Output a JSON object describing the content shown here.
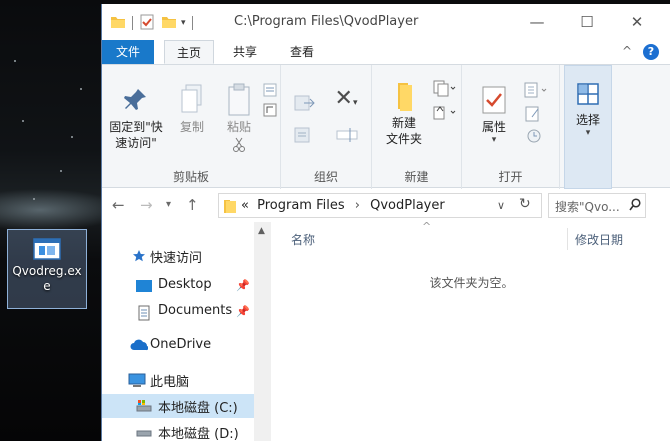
{
  "desktop": {
    "icon_label": "Qvodreg.exe"
  },
  "window": {
    "title": "C:\\Program Files\\QvodPlayer",
    "minimize": "—",
    "maximize": "☐",
    "close": "✕"
  },
  "tabs": {
    "file": "文件",
    "home": "主页",
    "share": "共享",
    "view": "查看",
    "collapse": "^",
    "help": "?"
  },
  "ribbon": {
    "clipboard": {
      "group": "剪贴板",
      "pin_line1": "固定到\"快",
      "pin_line2": "速访问\"",
      "copy": "复制",
      "paste": "粘贴"
    },
    "organize": {
      "group": "组织"
    },
    "new": {
      "group": "新建",
      "new_folder_line1": "新建",
      "new_folder_line2": "文件夹"
    },
    "open": {
      "group": "打开",
      "properties": "属性"
    },
    "select": {
      "label": "选择"
    }
  },
  "address": {
    "prefix": "«",
    "segment1": "Program Files",
    "separator": "›",
    "segment2": "QvodPlayer",
    "search_placeholder": "搜索\"Qvo..."
  },
  "navpane": {
    "items": [
      {
        "label": "快速访问"
      },
      {
        "label": "Desktop"
      },
      {
        "label": "Documents"
      },
      {
        "label": "OneDrive"
      },
      {
        "label": "此电脑"
      },
      {
        "label": "本地磁盘 (C:)"
      },
      {
        "label": "本地磁盘 (D:)"
      }
    ]
  },
  "content": {
    "col_name": "名称",
    "col_modified": "修改日期",
    "empty_message": "该文件夹为空。"
  }
}
